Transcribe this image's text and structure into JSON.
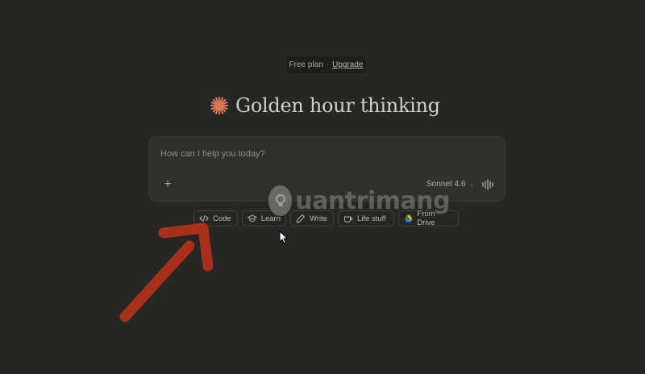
{
  "plan": {
    "label": "Free plan",
    "separator": "·",
    "upgrade": "Upgrade"
  },
  "greeting": {
    "title": "Golden hour thinking",
    "icon": "sparkle-icon",
    "accent": "#d97757"
  },
  "composer": {
    "placeholder": "How can I help you today?",
    "add_icon": "+",
    "model": "Sonnet 4.6",
    "model_chevron": "⌄"
  },
  "chips": [
    {
      "label": "Code",
      "icon": "code-icon"
    },
    {
      "label": "Learn",
      "icon": "graduation-cap-icon"
    },
    {
      "label": "Write",
      "icon": "pen-icon"
    },
    {
      "label": "Life stuff",
      "icon": "coffee-cup-icon"
    },
    {
      "label": "From Drive",
      "icon": "google-drive-icon"
    }
  ],
  "watermark": {
    "text": "uantrimang"
  },
  "colors": {
    "background": "#262625",
    "composer": "#30302e",
    "arrow": "#a6301a",
    "spark": "#d97757"
  }
}
